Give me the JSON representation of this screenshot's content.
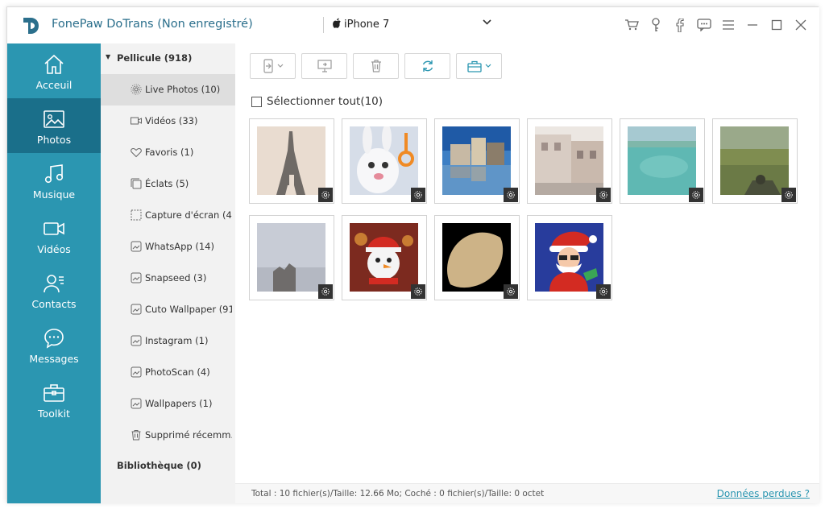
{
  "app": {
    "title": "FonePaw DoTrans (Non enregistré)"
  },
  "device": {
    "name": "iPhone 7"
  },
  "titlebar_icons": [
    "cart-icon",
    "key-icon",
    "facebook-icon",
    "chat-icon",
    "menu-icon",
    "minimize-icon",
    "maximize-icon",
    "close-icon"
  ],
  "nav": [
    {
      "label": "Acceuil",
      "icon": "home-icon"
    },
    {
      "label": "Photos",
      "icon": "photo-icon",
      "active": true
    },
    {
      "label": "Musique",
      "icon": "music-icon"
    },
    {
      "label": "Vidéos",
      "icon": "video-icon"
    },
    {
      "label": "Contacts",
      "icon": "contacts-icon"
    },
    {
      "label": "Messages",
      "icon": "messages-icon"
    },
    {
      "label": "Toolkit",
      "icon": "toolkit-icon"
    }
  ],
  "sub": {
    "pellicule": "Pellicule (918)",
    "items": [
      {
        "label": "Live Photos (10)",
        "icon": "live-photo-icon",
        "active": true
      },
      {
        "label": "Vidéos (33)",
        "icon": "video-icon"
      },
      {
        "label": "Favoris (1)",
        "icon": "heart-icon"
      },
      {
        "label": "Éclats (5)",
        "icon": "burst-icon"
      },
      {
        "label": "Capture d'écran (4...",
        "icon": "screenshot-icon"
      },
      {
        "label": "WhatsApp (14)",
        "icon": "album-icon"
      },
      {
        "label": "Snapseed (3)",
        "icon": "album-icon"
      },
      {
        "label": "Cuto Wallpaper (91)",
        "icon": "album-icon"
      },
      {
        "label": "Instagram (1)",
        "icon": "album-icon"
      },
      {
        "label": "PhotoScan (4)",
        "icon": "album-icon"
      },
      {
        "label": "Wallpapers (1)",
        "icon": "album-icon"
      },
      {
        "label": "Supprimé récemm...",
        "icon": "trash-icon"
      }
    ],
    "bibliotheque": "Bibliothèque (0)"
  },
  "toolbar": [
    "export-to-device-button",
    "export-to-pc-button",
    "delete-button",
    "refresh-button",
    "toolbox-button"
  ],
  "select_all": "Sélectionner tout(10)",
  "photos": [
    {
      "name": "eiffel-tower-photo"
    },
    {
      "name": "white-rabbit-photo"
    },
    {
      "name": "canal-houses-photo"
    },
    {
      "name": "street-building-photo"
    },
    {
      "name": "beach-sea-photo"
    },
    {
      "name": "game-field-photo"
    },
    {
      "name": "grey-sky-photo"
    },
    {
      "name": "snowman-photo"
    },
    {
      "name": "leaf-shape-photo"
    },
    {
      "name": "santa-claus-photo"
    }
  ],
  "status": {
    "text": "Total : 10 fichier(s)/Taille: 12.66 Mo; Coché : 0 fichier(s)/Taille: 0 octet",
    "link": "Données perdues ?"
  }
}
